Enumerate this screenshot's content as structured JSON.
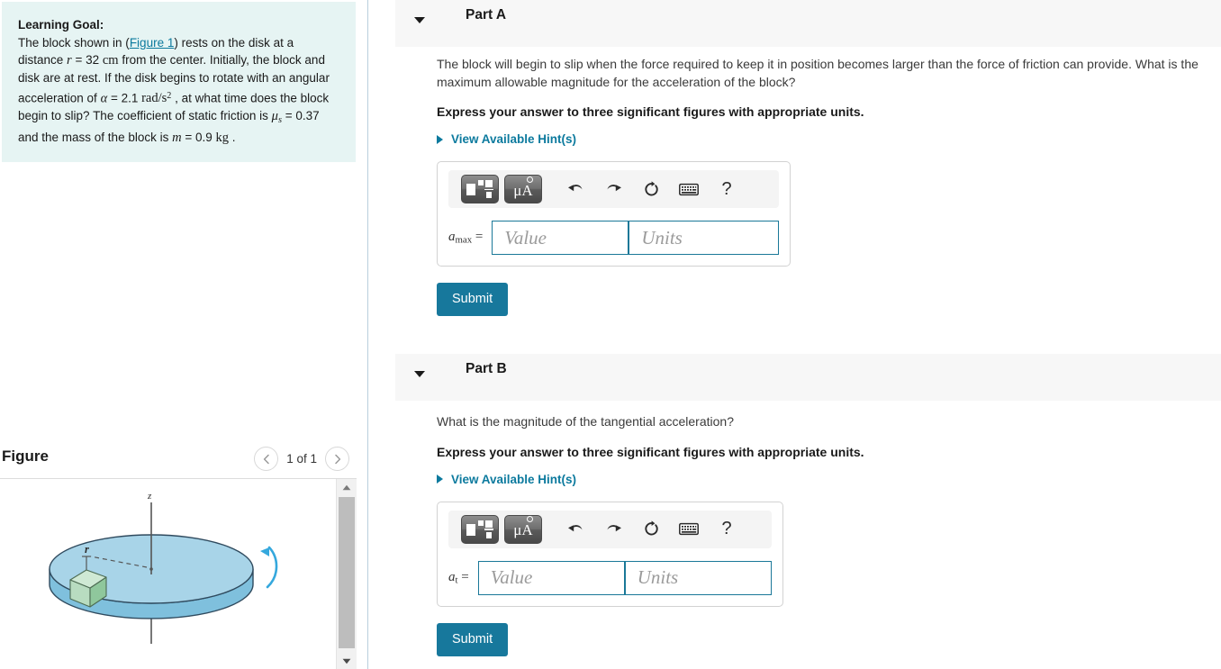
{
  "colors": {
    "accent_teal": "#17789c",
    "link_teal": "#0c7a9e",
    "goal_panel_bg": "#e6f4f3",
    "part_header_bg": "#f7f7f7",
    "input_border": "#1a7898",
    "disk_top": "#a8d4e8",
    "disk_edge": "#7fc0dd",
    "block_green": "#b8dcc0"
  },
  "left_panel": {
    "learning_goal": {
      "title": "Learning Goal:",
      "figure_link": "Figure 1",
      "text_part_1": "The block shown in (",
      "text_part_2": ") rests on the disk at a distance ",
      "var_r": "r",
      "text_part_3": " = 32 ",
      "unit_cm": "cm",
      "text_part_4": " from the center. Initially, the block and disk are at rest. If the disk begins to rotate with an angular acceleration of ",
      "var_alpha": "α",
      "text_part_5": " = 2.1 ",
      "unit_rad_s2_base": "rad/s",
      "unit_rad_s2_exp": "2",
      "text_part_6": " , at what time does the block begin to slip? The coefficient of static friction is ",
      "var_mu": "μ",
      "var_mu_sub": "s",
      "text_part_7": " = 0.37 and the mass of the block is ",
      "var_m": "m",
      "text_part_8": " = 0.9 ",
      "unit_kg": "kg",
      "text_part_9": " ."
    },
    "figure_section": {
      "title": "Figure",
      "counter": "1 of 1",
      "prev_icon": "chevron-left-icon",
      "next_icon": "chevron-right-icon",
      "diagram": {
        "axis_label": "z",
        "radius_label": "r"
      }
    }
  },
  "right_panel": {
    "parts": [
      {
        "label": "Part A",
        "question": "The block will begin to slip when the force required to keep it in position becomes larger than the force of friction can provide. What is the maximum allowable magnitude for the acceleration of the block?",
        "instruction": "Express your answer to three significant figures with appropriate units.",
        "hint_label": "View Available Hint(s)",
        "answer": {
          "symbol": "a",
          "symbol_sub": "max",
          "equals": "=",
          "value_placeholder": "Value",
          "units_placeholder": "Units",
          "value": "",
          "units": ""
        },
        "submit_label": "Submit"
      },
      {
        "label": "Part B",
        "question": "What is the magnitude of the tangential acceleration?",
        "instruction": "Express your answer to three significant figures with appropriate units.",
        "hint_label": "View Available Hint(s)",
        "answer": {
          "symbol": "a",
          "symbol_sub": "t",
          "equals": "=",
          "value_placeholder": "Value",
          "units_placeholder": "Units",
          "value": "",
          "units": ""
        },
        "submit_label": "Submit"
      }
    ],
    "math_toolbar": {
      "template_icon": "math-template-icon",
      "units_label": "μA",
      "units_icon": "micro-angstrom-icon",
      "undo_icon": "undo-icon",
      "redo_icon": "redo-icon",
      "reset_icon": "reset-icon",
      "keyboard_icon": "keyboard-icon",
      "help_label": "?",
      "help_icon": "help-icon"
    }
  }
}
